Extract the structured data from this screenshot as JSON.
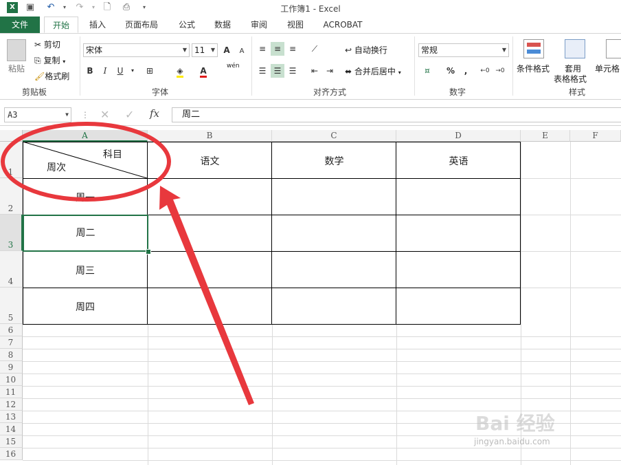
{
  "titlebar": {
    "title": "工作簿1 - Excel"
  },
  "quick_access": {
    "undo_icon": "undo-icon",
    "redo_icon": "redo-icon",
    "save_icon": "save-icon"
  },
  "tabs": [
    {
      "label": "文件"
    },
    {
      "label": "开始"
    },
    {
      "label": "插入"
    },
    {
      "label": "页面布局"
    },
    {
      "label": "公式"
    },
    {
      "label": "数据"
    },
    {
      "label": "审阅"
    },
    {
      "label": "视图"
    },
    {
      "label": "ACROBAT"
    }
  ],
  "ribbon": {
    "clipboard": {
      "paste": "粘贴",
      "cut": "剪切",
      "copy": "复制",
      "format_painter": "格式刷",
      "group": "剪贴板"
    },
    "font": {
      "name": "宋体",
      "size": "11",
      "bold": "B",
      "italic": "I",
      "underline": "U",
      "group": "字体",
      "grow": "A",
      "shrink": "A",
      "wen": "wén"
    },
    "align": {
      "wrap": "自动换行",
      "merge": "合并后居中",
      "group": "对齐方式"
    },
    "number": {
      "format": "常规",
      "percent": "%",
      "comma": ",",
      "group": "数字"
    },
    "styles": {
      "cond": "条件格式",
      "table_fmt_1": "套用",
      "table_fmt_2": "表格格式",
      "cell_styles": "单元格",
      "group": "样式"
    }
  },
  "formula_bar": {
    "name_box": "A3",
    "fx": "fx",
    "content": "周二"
  },
  "columns": [
    "A",
    "B",
    "C",
    "D",
    "E",
    "F"
  ],
  "rows": [
    "1",
    "2",
    "3",
    "4",
    "5",
    "6",
    "7",
    "8",
    "9",
    "10",
    "11",
    "12",
    "13",
    "14",
    "15",
    "16"
  ],
  "cells": {
    "A1_top": "科目",
    "A1_bottom": "周次",
    "B1": "语文",
    "C1": "数学",
    "D1": "英语",
    "A2": "周一",
    "A3": "周二",
    "A4": "周三",
    "A5": "周四"
  },
  "watermark": {
    "text": "Bai 经验",
    "sub": "jingyan.baidu.com"
  },
  "annotation_colors": {
    "red": "#e8383d",
    "excel_green": "#217346"
  }
}
